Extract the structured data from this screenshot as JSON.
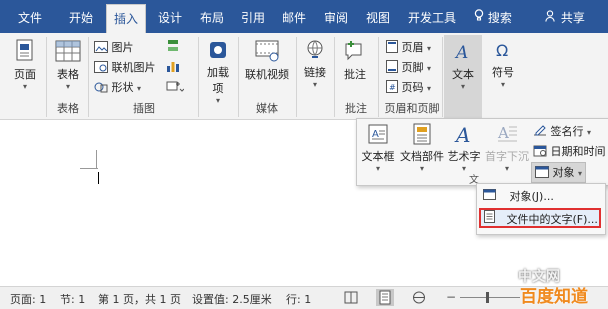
{
  "tabs": [
    {
      "label": "文件"
    },
    {
      "label": "开始"
    },
    {
      "label": "插入"
    },
    {
      "label": "设计"
    },
    {
      "label": "布局"
    },
    {
      "label": "引用"
    },
    {
      "label": "邮件"
    },
    {
      "label": "审阅"
    },
    {
      "label": "视图"
    },
    {
      "label": "开发工具"
    }
  ],
  "search_label": "搜索",
  "share_label": "共享",
  "groups": {
    "pages": {
      "button": "页面"
    },
    "tables": {
      "button": "表格",
      "label": "表格"
    },
    "illustrations": {
      "picture": "图片",
      "online_picture": "联机图片",
      "shapes": "形状",
      "label": "插图"
    },
    "addins": {
      "button": "加载项"
    },
    "media": {
      "button": "联机视频",
      "label": "媒体"
    },
    "links": {
      "button": "链接"
    },
    "comments": {
      "button": "批注",
      "label": "批注"
    },
    "headerfooter": {
      "header": "页眉",
      "footer": "页脚",
      "pagenum": "页码",
      "label": "页眉和页脚"
    },
    "text": {
      "button": "文本"
    },
    "symbols": {
      "button": "符号"
    }
  },
  "text_panel": {
    "textbox": "文本框",
    "quickparts": "文档部件",
    "wordart": "艺术字",
    "dropcap": "首字下沉",
    "signature": "签名行",
    "datetime": "日期和时间",
    "object": "对象",
    "group_letter": "文"
  },
  "object_menu": {
    "object_item": "对象(J)...",
    "text_from_file": "文件中的文字(F)..."
  },
  "status": {
    "page": "页面: 1",
    "section": "节: 1",
    "page_of": "第 1 页，共 1 页",
    "setting": "设置值: 2.5厘米",
    "line": "行: 1"
  },
  "watermark": "中文网",
  "watermark2": "百度知道",
  "colors": {
    "accent": "#2b579a",
    "highlight": "#e03030"
  }
}
